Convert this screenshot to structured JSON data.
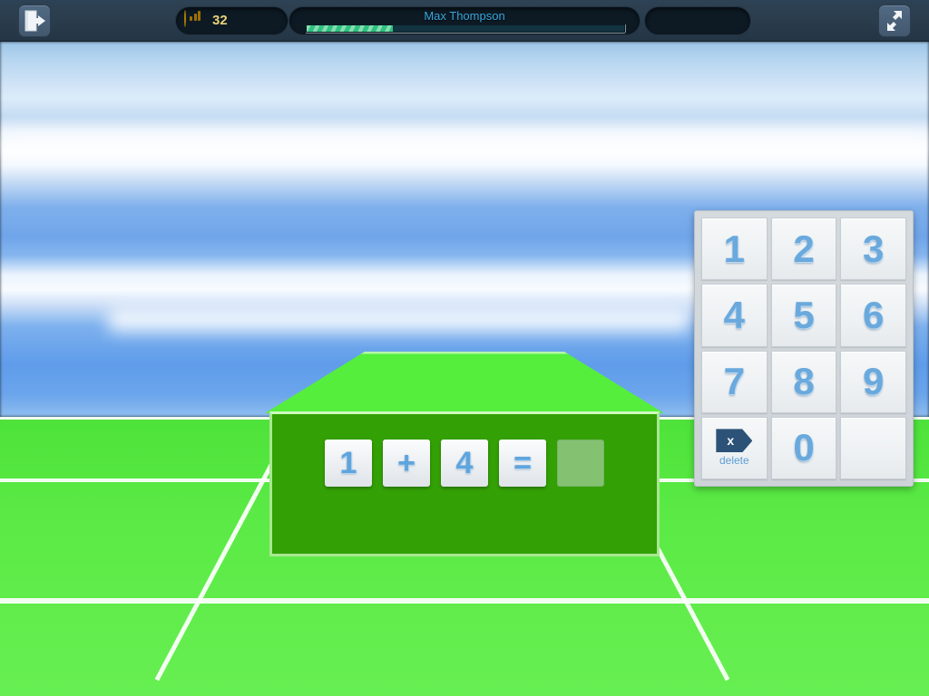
{
  "topbar": {
    "exit_icon": "exit-door-icon",
    "fullscreen_icon": "fullscreen-expand-icon",
    "coin_icon": "coin-bar-chart-icon",
    "coin_count": "32",
    "player_name": "Max Thompson",
    "xp_percent": 27,
    "spare_slot_label": ""
  },
  "scene": {
    "equation": {
      "tiles": [
        {
          "value": "1",
          "kind": "operand"
        },
        {
          "value": "+",
          "kind": "operator"
        },
        {
          "value": "4",
          "kind": "operand"
        },
        {
          "value": "=",
          "kind": "operator"
        },
        {
          "value": "",
          "kind": "answer"
        }
      ]
    },
    "colors": {
      "box_top": "#55ee3c",
      "box_front": "#33a005",
      "answer_tile": "#84c272",
      "ground": "#55ea41",
      "sky_blue": "#6fa5ea",
      "accent_blue": "#6aa9dd",
      "topbar": "#2a3d4d",
      "coin_gold": "#f5c32c",
      "xp_green": "#2ec27e"
    }
  },
  "keypad": {
    "keys": [
      {
        "label": "1",
        "name": "key-1",
        "type": "digit"
      },
      {
        "label": "2",
        "name": "key-2",
        "type": "digit"
      },
      {
        "label": "3",
        "name": "key-3",
        "type": "digit"
      },
      {
        "label": "4",
        "name": "key-4",
        "type": "digit"
      },
      {
        "label": "5",
        "name": "key-5",
        "type": "digit"
      },
      {
        "label": "6",
        "name": "key-6",
        "type": "digit"
      },
      {
        "label": "7",
        "name": "key-7",
        "type": "digit"
      },
      {
        "label": "8",
        "name": "key-8",
        "type": "digit"
      },
      {
        "label": "9",
        "name": "key-9",
        "type": "digit"
      },
      {
        "label": "delete",
        "name": "key-delete",
        "type": "delete",
        "glyph": "x"
      },
      {
        "label": "0",
        "name": "key-0",
        "type": "digit"
      },
      {
        "label": "",
        "name": "key-blank",
        "type": "blank"
      }
    ]
  }
}
